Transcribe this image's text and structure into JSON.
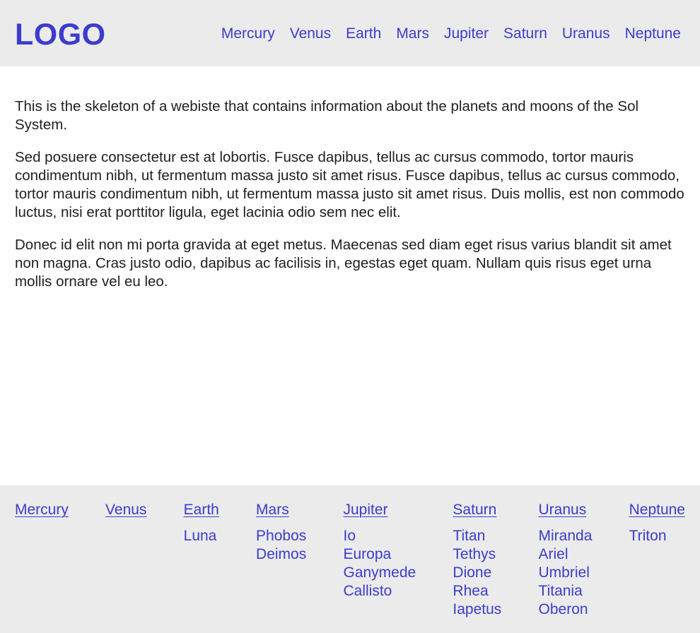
{
  "header": {
    "logo": "LOGO",
    "nav": [
      "Mercury",
      "Venus",
      "Earth",
      "Mars",
      "Jupiter",
      "Saturn",
      "Uranus",
      "Neptune"
    ]
  },
  "main": {
    "paragraphs": [
      "This is the skeleton of a webiste that contains information about the planets and moons of the Sol System.",
      "Sed posuere consectetur est at lobortis. Fusce dapibus, tellus ac cursus commodo, tortor mauris condimentum nibh, ut fermentum massa justo sit amet risus. Fusce dapibus, tellus ac cursus commodo, tortor mauris condimentum nibh, ut fermentum massa justo sit amet risus. Duis mollis, est non commodo luctus, nisi erat porttitor ligula, eget lacinia odio sem nec elit.",
      "Donec id elit non mi porta gravida at eget metus. Maecenas sed diam eget risus varius blandit sit amet non magna. Cras justo odio, dapibus ac facilisis in, egestas eget quam. Nullam quis risus eget urna mollis ornare vel eu leo."
    ]
  },
  "footer": {
    "planets": [
      {
        "name": "Mercury",
        "moons": []
      },
      {
        "name": "Venus",
        "moons": []
      },
      {
        "name": "Earth",
        "moons": [
          "Luna"
        ]
      },
      {
        "name": "Mars",
        "moons": [
          "Phobos",
          "Deimos"
        ]
      },
      {
        "name": "Jupiter",
        "moons": [
          "Io",
          "Europa",
          "Ganymede",
          "Callisto"
        ]
      },
      {
        "name": "Saturn",
        "moons": [
          "Titan",
          "Tethys",
          "Dione",
          "Rhea",
          "Iapetus"
        ]
      },
      {
        "name": "Uranus",
        "moons": [
          "Miranda",
          "Ariel",
          "Umbriel",
          "Titania",
          "Oberon"
        ]
      },
      {
        "name": "Neptune",
        "moons": [
          "Triton"
        ]
      }
    ]
  },
  "colors": {
    "accent": "#3c3ccc",
    "band_background": "#ebebeb",
    "text": "#1f1f1f"
  }
}
